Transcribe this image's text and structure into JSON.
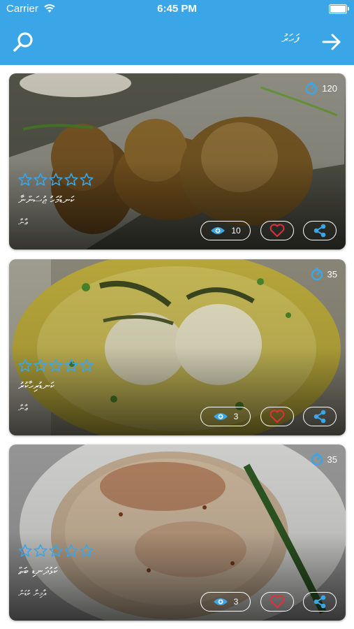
{
  "status": {
    "carrier": "Carrier",
    "time": "6:45 PM"
  },
  "header": {
    "title": "ފަހަރު"
  },
  "colors": {
    "accent": "#3aa6e8",
    "like": "#e0303e"
  },
  "recipes": [
    {
      "name": "ކަނޑުމަހު ޖުސަންނާ",
      "author": "ޢާނާ",
      "time": "120",
      "views": "10",
      "rating": 0
    },
    {
      "name": "ކަނޑުރިހާކުރު",
      "author": "ޢާނާ",
      "time": "35",
      "views": "3",
      "rating": 0
    },
    {
      "name": "ކަޅުދަނޑި ބަތް",
      "author": "އާމިނާ ކުޑަން",
      "time": "35",
      "views": "3",
      "rating": 0
    }
  ]
}
